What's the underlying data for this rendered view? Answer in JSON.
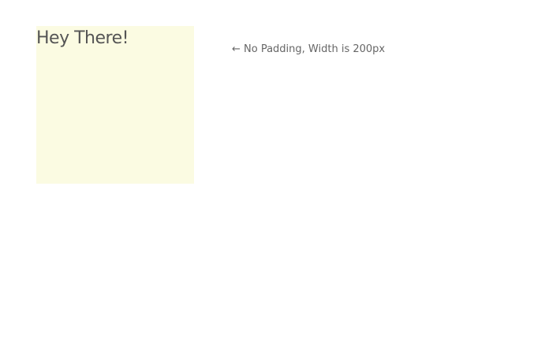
{
  "box": {
    "text": "Hey There!",
    "background_color": "#fbfbe2"
  },
  "annotation": {
    "text": "← No Padding, Width is 200px"
  }
}
